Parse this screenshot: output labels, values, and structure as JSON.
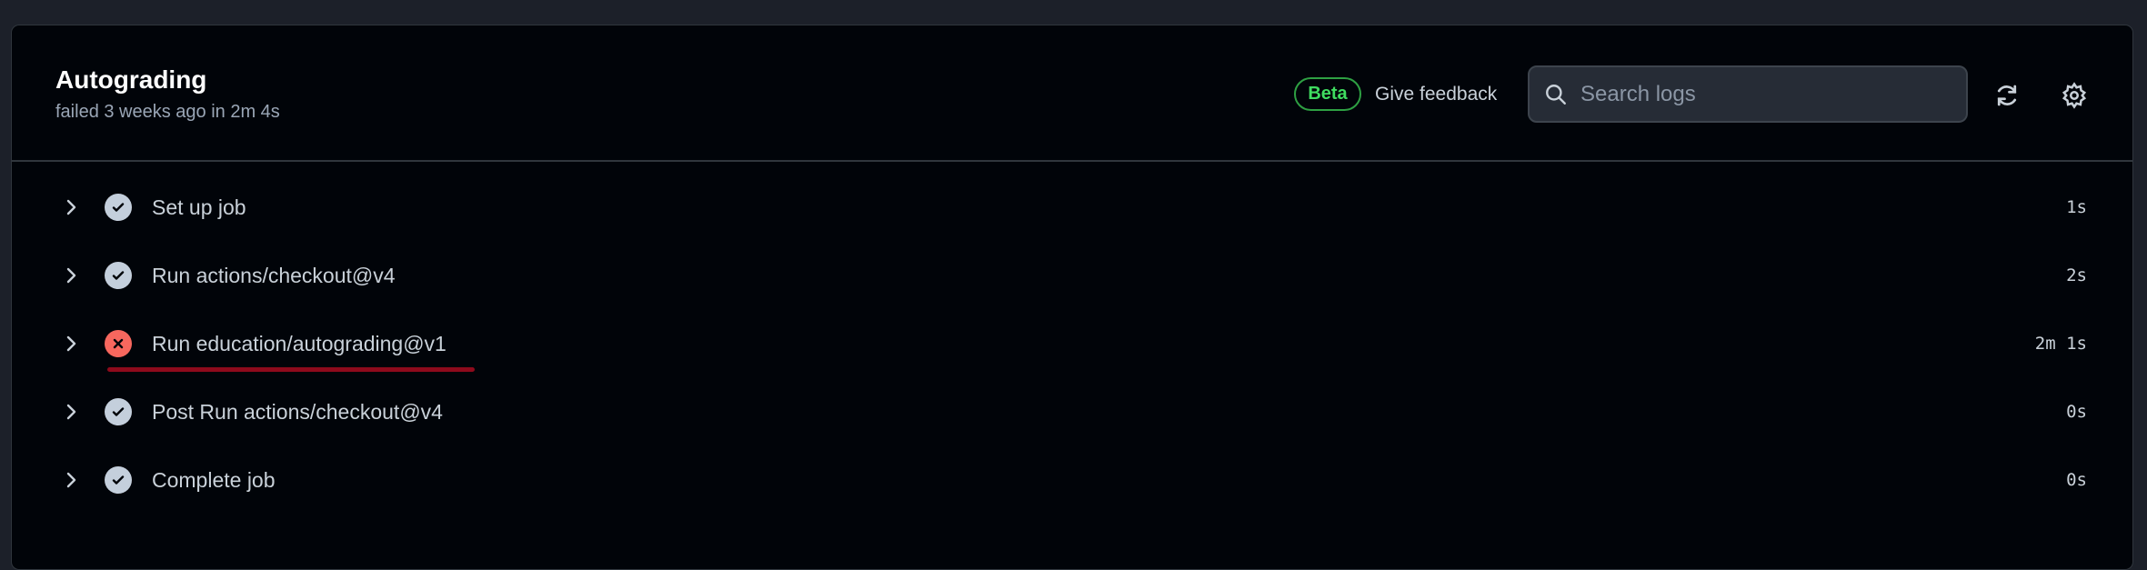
{
  "job": {
    "title": "Autograding",
    "subtitle": "failed 3 weeks ago in 2m 4s"
  },
  "toolbar": {
    "beta_label": "Beta",
    "feedback_label": "Give feedback",
    "search_placeholder": "Search logs"
  },
  "steps": [
    {
      "label": "Set up job",
      "duration": "1s",
      "status": "success"
    },
    {
      "label": "Run actions/checkout@v4",
      "duration": "2s",
      "status": "success"
    },
    {
      "label": "Run education/autograding@v1",
      "duration": "2m 1s",
      "status": "failure"
    },
    {
      "label": "Post Run actions/checkout@v4",
      "duration": "0s",
      "status": "success"
    },
    {
      "label": "Complete job",
      "duration": "0s",
      "status": "success"
    }
  ],
  "colors": {
    "success": "#c4cfdc",
    "failure": "#f7675e",
    "beta": "#3fdc60"
  }
}
